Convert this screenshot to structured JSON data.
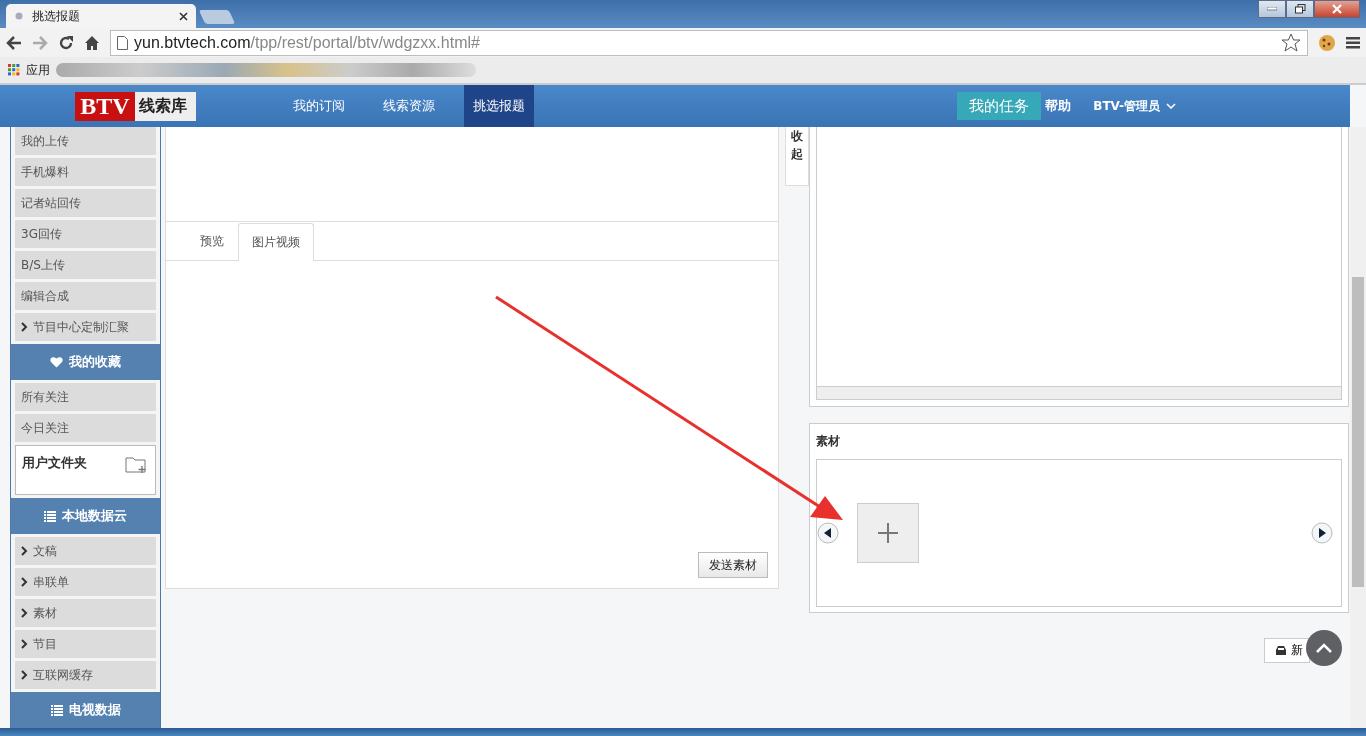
{
  "browser": {
    "tab_title": "挑选报题",
    "url_host": "yun.btvtech.com",
    "url_path": "/tpp/rest/portal/btv/wdgzxx.html#",
    "bookmarks_label": "应用"
  },
  "header": {
    "logo_mark": "BTV",
    "logo_text": "线索库",
    "nav": [
      {
        "label": "我的订阅",
        "selected": false
      },
      {
        "label": "线索资源",
        "selected": false
      },
      {
        "label": "挑选报题",
        "selected": true
      }
    ],
    "task_button": "我的任务",
    "help": "帮助",
    "user": "BTV-管理员"
  },
  "sidebar": {
    "items": [
      {
        "kind": "item",
        "label": "我的上传"
      },
      {
        "kind": "item",
        "label": "手机爆料"
      },
      {
        "kind": "item",
        "label": "记者站回传"
      },
      {
        "kind": "item",
        "label": "3G回传"
      },
      {
        "kind": "item",
        "label": "B/S上传"
      },
      {
        "kind": "item",
        "label": "编辑合成"
      },
      {
        "kind": "expandable",
        "label": "节目中心定制汇聚"
      },
      {
        "kind": "favorites_header",
        "label": "我的收藏"
      },
      {
        "kind": "item",
        "label": "所有关注"
      },
      {
        "kind": "item",
        "label": "今日关注"
      },
      {
        "kind": "folder",
        "label": "用户文件夹"
      },
      {
        "kind": "list_header",
        "label": "本地数据云"
      },
      {
        "kind": "expandable",
        "label": "文稿"
      },
      {
        "kind": "expandable",
        "label": "串联单"
      },
      {
        "kind": "expandable",
        "label": "素材"
      },
      {
        "kind": "expandable",
        "label": "节目"
      },
      {
        "kind": "expandable",
        "label": "互联网缓存"
      },
      {
        "kind": "list_header",
        "label": "电视数据"
      }
    ]
  },
  "preview": {
    "tabs": [
      {
        "label": "预览",
        "selected": false
      },
      {
        "label": "图片视频",
        "selected": true
      }
    ],
    "send_button": "发送素材"
  },
  "right": {
    "collapse_tab": "收起",
    "material": {
      "title": "素材"
    },
    "partial_button": "新"
  }
}
